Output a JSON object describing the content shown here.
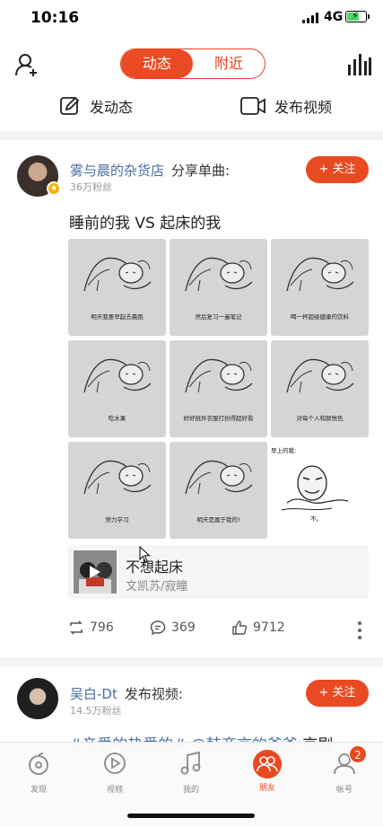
{
  "status_bar": {
    "time": "10:16",
    "network": "4G"
  },
  "topnav": {
    "tabs": [
      {
        "label": "动态",
        "active": true
      },
      {
        "label": "附近",
        "active": false
      }
    ]
  },
  "actions": {
    "post_label": "发动态",
    "video_label": "发布视频"
  },
  "post1": {
    "author": "雾与晨的杂货店",
    "verb": "分享单曲:",
    "fans": "36万粉丝",
    "follow_label": "+ 关注",
    "text": "睡前的我 VS 起床的我",
    "panels": [
      "明天我要早起去晨跑",
      "然后复习一遍笔记",
      "喝一杯超级健康的饮料",
      "吃水果",
      "好好挑件衣服打扮得超好看",
      "对每个人和颜悦色",
      "努力学习",
      "明天是属于我的!"
    ],
    "meme": {
      "top_text": "早上的我:",
      "bottom_text": "不。"
    },
    "song": {
      "title": "不想起床",
      "artist": "文凯苏/寂瞳"
    },
    "stats": {
      "reposts": "796",
      "comments": "369",
      "likes": "9712"
    }
  },
  "post2": {
    "author": "吴白-Dt",
    "verb": "发布视频:",
    "fans": "14.5万粉丝",
    "follow_label": "+ 关注",
    "text_tag": "#亲爱的热爱的# @韩商言的爸爸",
    "text_plain": " 京剧"
  },
  "tabbar": {
    "tabs": [
      {
        "label": "发现",
        "icon": "disc-icon"
      },
      {
        "label": "视频",
        "icon": "video-play-icon"
      },
      {
        "label": "我的",
        "icon": "music-note-icon"
      },
      {
        "label": "朋友",
        "icon": "friends-icon",
        "active": true
      },
      {
        "label": "帐号",
        "icon": "account-icon"
      }
    ],
    "badge_count": "2"
  },
  "colors": {
    "accent": "#e94a22",
    "link": "#4a6fa5"
  }
}
